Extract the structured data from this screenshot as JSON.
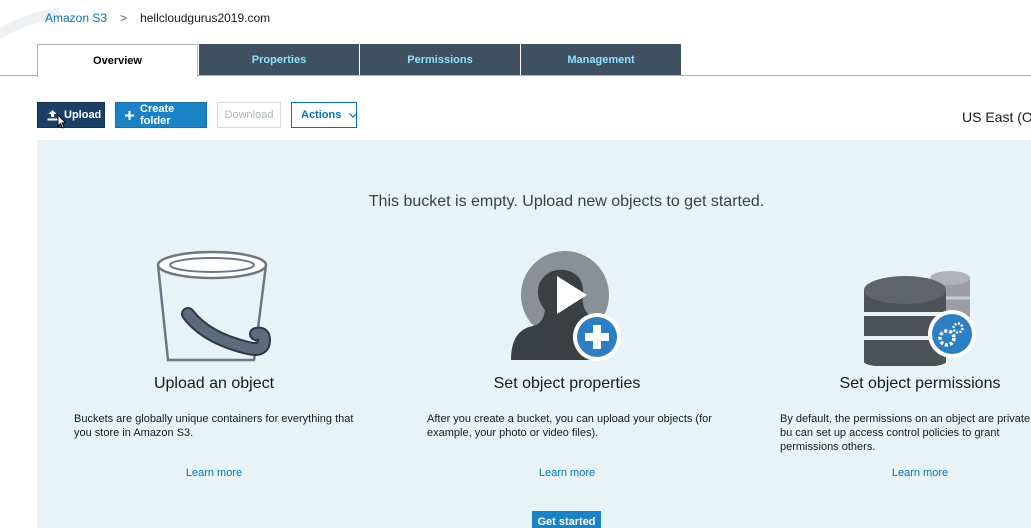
{
  "breadcrumb": {
    "root": "Amazon S3",
    "separator": ">",
    "current": "hellcloudgurus2019.com"
  },
  "tabs": [
    {
      "label": "Overview",
      "active": true
    },
    {
      "label": "Properties",
      "active": false
    },
    {
      "label": "Permissions",
      "active": false
    },
    {
      "label": "Management",
      "active": false
    }
  ],
  "toolbar": {
    "upload_label": "Upload",
    "create_folder_label": "Create folder",
    "download_label": "Download",
    "actions_label": "Actions"
  },
  "region": "US East (Oh",
  "empty_state": {
    "message": "This bucket is empty. Upload new objects to get started.",
    "cards": [
      {
        "title": "Upload an object",
        "description": "Buckets are globally unique containers for everything that you store in Amazon S3.",
        "link": "Learn more",
        "icon": "bucket-icon"
      },
      {
        "title": "Set object properties",
        "description": "After you create a bucket, you can upload your objects (for example, your photo or video files).",
        "link": "Learn more",
        "icon": "media-add-icon"
      },
      {
        "title": "Set object permissions",
        "description": "By default, the permissions on an object are private, bu can set up access control policies to grant permissions others.",
        "link": "Learn more",
        "icon": "database-settings-icon"
      }
    ],
    "get_started_label": "Get started"
  },
  "colors": {
    "tab_inactive_bg": "#3f5160",
    "tab_inactive_text": "#8ee0ff",
    "upload_bg": "#1b3f66",
    "primary_blue": "#1a83c6",
    "link_blue": "#0073bb",
    "panel_bg": "#e8f3f8"
  }
}
